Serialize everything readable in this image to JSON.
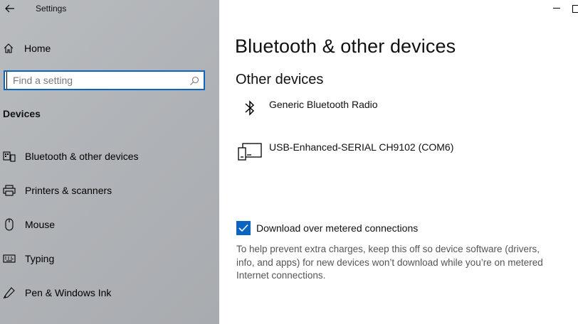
{
  "window": {
    "app_title": "Settings"
  },
  "sidebar": {
    "home_label": "Home",
    "search_placeholder": "Find a setting",
    "section_heading": "Devices",
    "items": [
      {
        "label": "Bluetooth & other devices",
        "icon": "bluetooth-devices-icon"
      },
      {
        "label": "Printers & scanners",
        "icon": "printer-icon"
      },
      {
        "label": "Mouse",
        "icon": "mouse-icon"
      },
      {
        "label": "Typing",
        "icon": "keyboard-icon"
      },
      {
        "label": "Pen & Windows Ink",
        "icon": "pen-icon"
      }
    ]
  },
  "main": {
    "page_title": "Bluetooth & other devices",
    "section_title": "Other devices",
    "devices": [
      {
        "name": "Generic Bluetooth Radio",
        "icon": "bluetooth-icon"
      },
      {
        "name": "USB-Enhanced-SERIAL CH9102 (COM6)",
        "icon": "generic-device-icon"
      }
    ],
    "metered": {
      "label": "Download over metered connections",
      "checked": true,
      "help": "To help prevent extra charges, keep this off so device software (drivers, info, and apps) for new devices won’t download while you’re on metered Internet connections."
    }
  },
  "colors": {
    "accent": "#0a64c0",
    "sidebar_bg": "#b1b4b8"
  }
}
